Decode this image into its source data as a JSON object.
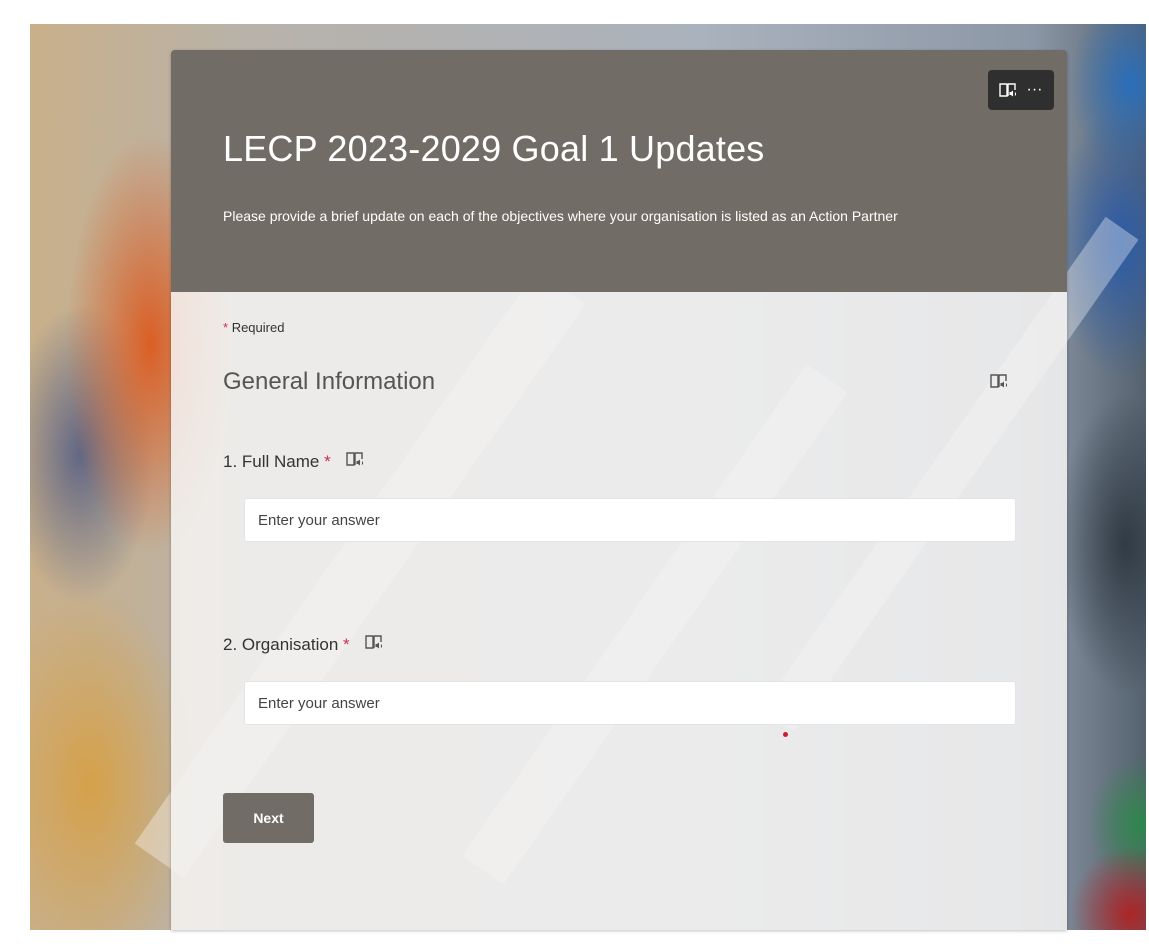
{
  "form": {
    "title": "LECP 2023-2029 Goal 1 Updates",
    "description": "Please provide a brief update on each of the objectives where your organisation is listed as an Action Partner",
    "required_star": "*",
    "required_label": "Required",
    "toolbar": {
      "immersive_reader_icon": "immersive-reader-icon",
      "more_options_glyph": "···"
    },
    "section": {
      "title": "General Information",
      "icon": "immersive-reader-icon"
    },
    "questions": [
      {
        "label": "1. Full Name",
        "required_star": "*",
        "placeholder": "Enter your answer",
        "value": ""
      },
      {
        "label": "2. Organisation",
        "required_star": "*",
        "placeholder": "Enter your answer",
        "value": ""
      }
    ],
    "next_label": "Next"
  },
  "colors": {
    "header": "#716c66",
    "required_star": "#c4314b",
    "button": "#716c66"
  }
}
